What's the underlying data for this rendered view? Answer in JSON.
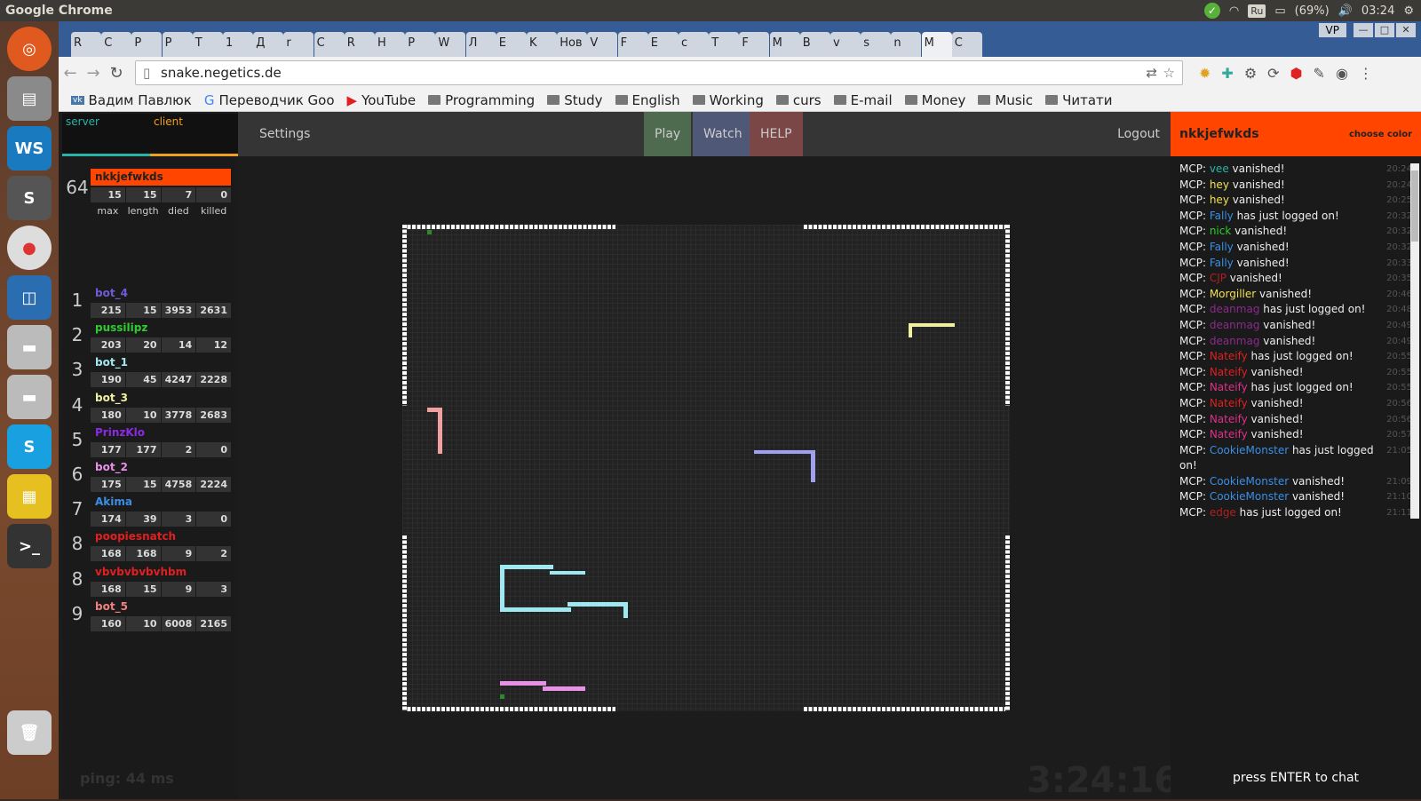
{
  "os": {
    "app_title": "Google Chrome",
    "battery": "(69%)",
    "time": "03:24",
    "lang": "Ru"
  },
  "browser": {
    "tabs": [
      "R",
      "C",
      "P",
      "P",
      "T",
      "1",
      "Д",
      "r",
      "C",
      "R",
      "H",
      "P",
      "W",
      "Л",
      "E",
      "K",
      "Нов",
      "V",
      "F",
      "E",
      "c",
      "T",
      "F",
      "M",
      "B",
      "v",
      "s",
      "n",
      "M",
      "C"
    ],
    "vp": "VP",
    "url": "snake.negetics.de",
    "bookmarks": [
      "Вадим Павлюк",
      "Переводчик Goo",
      "YouTube",
      "Programming",
      "Study",
      "English",
      "Working",
      "curs",
      "E-mail",
      "Money",
      "Music",
      "Читати"
    ]
  },
  "game": {
    "graph_server": "server",
    "graph_client": "client",
    "menu": {
      "settings": "Settings",
      "play": "Play",
      "watch": "Watch",
      "help": "HELP",
      "logout": "Logout"
    },
    "user": {
      "name": "nkkjefwkds",
      "choose_color": "choose color"
    },
    "self": {
      "rank": "64",
      "name": "nkkjefwkds",
      "max": "15",
      "length": "15",
      "died": "7",
      "killed": "0"
    },
    "stat_labels": [
      "max",
      "length",
      "died",
      "killed"
    ],
    "leaderboard": [
      {
        "rank": "1",
        "name": "bot_4",
        "color": "#6f5bd8",
        "max": "215",
        "length": "15",
        "died": "3953",
        "killed": "2631"
      },
      {
        "rank": "2",
        "name": "pussilipz",
        "color": "#2ecc2e",
        "max": "203",
        "length": "20",
        "died": "14",
        "killed": "12"
      },
      {
        "rank": "3",
        "name": "bot_1",
        "color": "#a0e8f0",
        "max": "190",
        "length": "45",
        "died": "4247",
        "killed": "2228"
      },
      {
        "rank": "4",
        "name": "bot_3",
        "color": "#f0f0a0",
        "max": "180",
        "length": "10",
        "died": "3778",
        "killed": "2683"
      },
      {
        "rank": "5",
        "name": "PrinzKlo",
        "color": "#8a2be2",
        "max": "177",
        "length": "177",
        "died": "2",
        "killed": "0"
      },
      {
        "rank": "6",
        "name": "bot_2",
        "color": "#e890e8",
        "max": "175",
        "length": "15",
        "died": "4758",
        "killed": "2224"
      },
      {
        "rank": "7",
        "name": "Akima",
        "color": "#3a8ee6",
        "max": "174",
        "length": "39",
        "died": "3",
        "killed": "0"
      },
      {
        "rank": "8",
        "name": "poopiesnatch",
        "color": "#e02020",
        "max": "168",
        "length": "168",
        "died": "9",
        "killed": "2"
      },
      {
        "rank": "8",
        "name": "vbvbvbvbvhbm",
        "color": "#e02020",
        "max": "168",
        "length": "15",
        "died": "9",
        "killed": "3"
      },
      {
        "rank": "9",
        "name": "bot_5",
        "color": "#f08080",
        "max": "160",
        "length": "10",
        "died": "6008",
        "killed": "2165"
      }
    ],
    "ping": "ping: 44 ms",
    "clock": "3:24:16",
    "chat": [
      {
        "who": "vee",
        "color": "#29b3a7",
        "msg": " vanished!",
        "time": "20:24"
      },
      {
        "who": "hey",
        "color": "#f0e050",
        "msg": " vanished!",
        "time": "20:24"
      },
      {
        "who": "hey",
        "color": "#f0e050",
        "msg": " vanished!",
        "time": "20:25"
      },
      {
        "who": "Fally",
        "color": "#3a8ee6",
        "msg": " has just logged on!",
        "time": "20:32"
      },
      {
        "who": "nick",
        "color": "#2ecc2e",
        "msg": " vanished!",
        "time": "20:32"
      },
      {
        "who": "Fally",
        "color": "#3a8ee6",
        "msg": " vanished!",
        "time": "20:32"
      },
      {
        "who": "Fally",
        "color": "#3a8ee6",
        "msg": " vanished!",
        "time": "20:33"
      },
      {
        "who": "CJP",
        "color": "#b02020",
        "msg": " vanished!",
        "time": "20:35"
      },
      {
        "who": "Morgiller",
        "color": "#f0e050",
        "msg": " vanished!",
        "time": "20:46"
      },
      {
        "who": "deanmag",
        "color": "#8a2b8a",
        "msg": " has just logged on!",
        "time": "20:48"
      },
      {
        "who": "deanmag",
        "color": "#8a2b8a",
        "msg": " vanished!",
        "time": "20:49"
      },
      {
        "who": "deanmag",
        "color": "#8a2b8a",
        "msg": " vanished!",
        "time": "20:49"
      },
      {
        "who": "Nateify",
        "color": "#e02020",
        "msg": " has just logged on!",
        "time": "20:55"
      },
      {
        "who": "Nateify",
        "color": "#e02020",
        "msg": " vanished!",
        "time": "20:55"
      },
      {
        "who": "Nateify",
        "color": "#e0308a",
        "msg": " has just logged on!",
        "time": "20:55"
      },
      {
        "who": "Nateify",
        "color": "#e02020",
        "msg": " vanished!",
        "time": "20:56"
      },
      {
        "who": "Nateify",
        "color": "#e0308a",
        "msg": " vanished!",
        "time": "20:56"
      },
      {
        "who": "Nateify",
        "color": "#e0308a",
        "msg": " vanished!",
        "time": "20:57"
      },
      {
        "who": "CookieMonster",
        "color": "#3a8ee6",
        "msg": " has just logged on!",
        "time": "21:05"
      },
      {
        "who": "CookieMonster",
        "color": "#3a8ee6",
        "msg": " vanished!",
        "time": "21:09"
      },
      {
        "who": "CookieMonster",
        "color": "#3a8ee6",
        "msg": " vanished!",
        "time": "21:10"
      },
      {
        "who": "edge",
        "color": "#b02020",
        "msg": " has just logged on!",
        "time": "21:11"
      }
    ],
    "chat_prefix": "MCP: ",
    "chat_hint": "press ENTER to chat"
  }
}
